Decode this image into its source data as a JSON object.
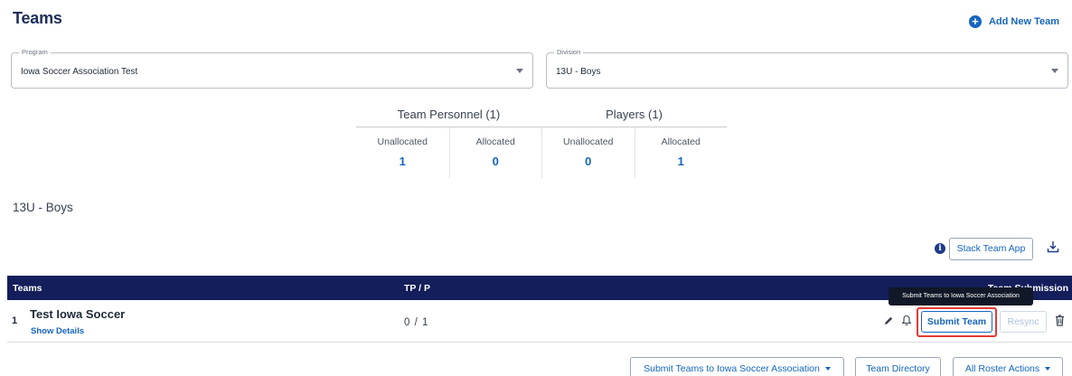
{
  "header": {
    "title": "Teams",
    "add_team_label": "Add New Team",
    "add_icon": "plus-circle-icon"
  },
  "filters": {
    "program": {
      "legend": "Program",
      "value": "Iowa Soccer Association Test"
    },
    "division": {
      "legend": "Division",
      "value": "13U - Boys"
    }
  },
  "stats": {
    "groups": [
      "Team Personnel (1)",
      "Players (1)"
    ],
    "columns": [
      {
        "label": "Unallocated",
        "value": "1"
      },
      {
        "label": "Allocated",
        "value": "0"
      },
      {
        "label": "Unallocated",
        "value": "0"
      },
      {
        "label": "Allocated",
        "value": "1"
      }
    ]
  },
  "division_heading": "13U - Boys",
  "toolbar": {
    "stack_team_app": "Stack Team App",
    "info_icon": "info-icon",
    "download_icon": "download-icon"
  },
  "table": {
    "headers": {
      "teams": "Teams",
      "tp": "TP / P",
      "submission": "Team Submission"
    },
    "tooltip": "Submit Teams to Iowa Soccer Association",
    "rows": [
      {
        "index": "1",
        "name": "Test Iowa Soccer",
        "show_details": "Show Details",
        "tp": "0 / 1",
        "submit_label": "Submit Team",
        "resync_label": "Resync"
      }
    ]
  },
  "footer": {
    "submit_teams": "Submit Teams to Iowa Soccer Association",
    "team_directory": "Team Directory",
    "all_roster_actions": "All Roster Actions"
  },
  "colors": {
    "navy": "#141e5a",
    "accent": "#1565c0",
    "highlight": "#e53935"
  }
}
